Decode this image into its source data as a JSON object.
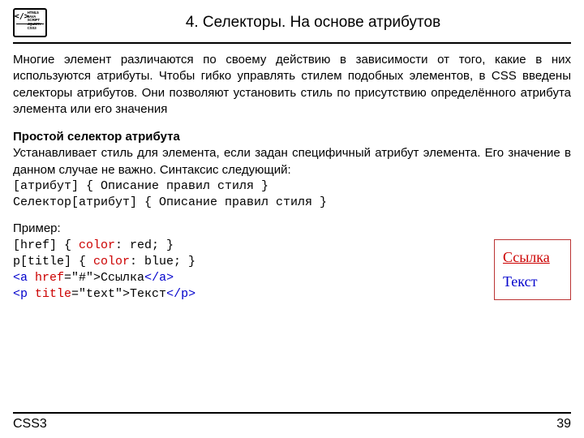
{
  "header": {
    "logo_lines": "HTML5\nJAVA SCRIPT\nJQUERY\nCSS3",
    "logo_symbol": "</>",
    "title": "4. Селекторы. На основе атрибутов"
  },
  "content": {
    "intro": "Многие элемент различаются по своему действию в зависимости от того, какие в них используются атрибуты. Чтобы гибко управлять стилем подобных элементов, в CSS введены селекторы атрибутов. Они позволяют установить стиль по присутствию определённого атрибута элемента или его значения",
    "subheading": "Простой селектор атрибута",
    "sub_desc": "Устанавливает стиль для элемента, если задан специфичный атрибут элемента. Его значение в данном случае не важно. Синтаксис следующий:",
    "syntax1": "[атрибут] { Описание правил стиля }",
    "syntax2": "Селектор[атрибут] { Описание правил стиля }",
    "example_label": "Пример:",
    "ex_line1_a": "[href] { ",
    "ex_line1_b": "color",
    "ex_line1_c": ": red; }",
    "ex_line2_a": "p[title] { ",
    "ex_line2_b": "color",
    "ex_line2_c": ": blue; }",
    "ex_line3_a": "<a",
    "ex_line3_b": " href",
    "ex_line3_c": "=\"#\">",
    "ex_line3_d": "Ссылка",
    "ex_line3_e": "</a>",
    "ex_line4_a": "<p",
    "ex_line4_b": " title",
    "ex_line4_c": "=\"text\">",
    "ex_line4_d": "Текст",
    "ex_line4_e": "</p>",
    "box_link": "Ссылка",
    "box_text": "Текст"
  },
  "footer": {
    "left": "CSS3",
    "page": "39"
  }
}
